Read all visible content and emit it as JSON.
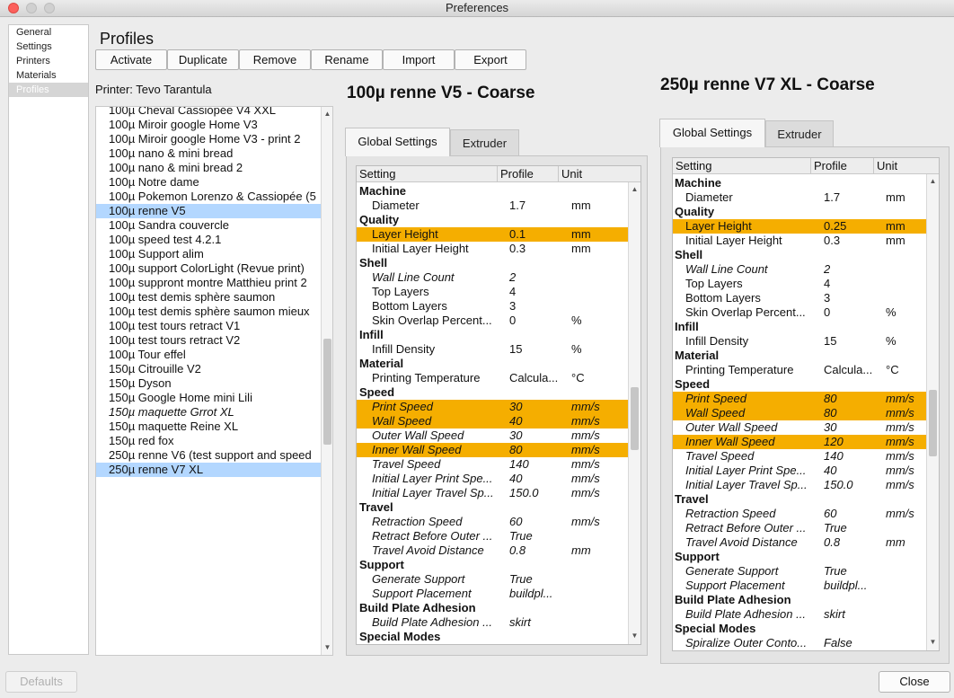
{
  "window": {
    "title": "Preferences"
  },
  "categories": [
    {
      "label": "General",
      "selected": false
    },
    {
      "label": "Settings",
      "selected": false
    },
    {
      "label": "Printers",
      "selected": false
    },
    {
      "label": "Materials",
      "selected": false
    },
    {
      "label": "Profiles",
      "selected": true
    }
  ],
  "page": {
    "heading": "Profiles",
    "printer_label": "Printer: Tevo Tarantula"
  },
  "toolbar": [
    "Activate",
    "Duplicate",
    "Remove",
    "Rename",
    "Import",
    "Export"
  ],
  "profiles": [
    {
      "name": "100µ Cheval Cassiopée V4 XXL",
      "selected": false,
      "italic": false
    },
    {
      "name": "100µ Miroir google Home V3",
      "selected": false,
      "italic": false
    },
    {
      "name": "100µ Miroir google Home V3 - print 2",
      "selected": false,
      "italic": false
    },
    {
      "name": "100µ nano & mini bread",
      "selected": false,
      "italic": false
    },
    {
      "name": "100µ nano & mini bread 2",
      "selected": false,
      "italic": false
    },
    {
      "name": "100µ Notre dame",
      "selected": false,
      "italic": false
    },
    {
      "name": "100µ Pokemon Lorenzo & Cassiopée (5",
      "selected": false,
      "italic": false
    },
    {
      "name": "100µ renne V5",
      "selected": true,
      "italic": false
    },
    {
      "name": "100µ Sandra couvercle",
      "selected": false,
      "italic": false
    },
    {
      "name": "100µ speed test 4.2.1",
      "selected": false,
      "italic": false
    },
    {
      "name": "100µ Support alim",
      "selected": false,
      "italic": false
    },
    {
      "name": "100µ support ColorLight (Revue print)",
      "selected": false,
      "italic": false
    },
    {
      "name": "100µ suppront montre Matthieu print 2",
      "selected": false,
      "italic": false
    },
    {
      "name": "100µ test demis sphère saumon",
      "selected": false,
      "italic": false
    },
    {
      "name": "100µ test demis sphère saumon mieux",
      "selected": false,
      "italic": false
    },
    {
      "name": "100µ test tours retract V1",
      "selected": false,
      "italic": false
    },
    {
      "name": "100µ test tours retract V2",
      "selected": false,
      "italic": false
    },
    {
      "name": "100µ Tour effel",
      "selected": false,
      "italic": false
    },
    {
      "name": "150µ Citrouille V2",
      "selected": false,
      "italic": false
    },
    {
      "name": "150µ Dyson",
      "selected": false,
      "italic": false
    },
    {
      "name": "150µ Google Home mini Lili",
      "selected": false,
      "italic": false
    },
    {
      "name": "150µ maquette Grrot XL",
      "selected": false,
      "italic": true
    },
    {
      "name": "150µ maquette Reine XL",
      "selected": false,
      "italic": false
    },
    {
      "name": "150µ red fox",
      "selected": false,
      "italic": false
    },
    {
      "name": "250µ renne V6 (test support and speed",
      "selected": false,
      "italic": false
    },
    {
      "name": "250µ renne V7 XL",
      "selected": true,
      "italic": false
    }
  ],
  "left_panel": {
    "title": "100µ renne V5 - Coarse",
    "tabs": [
      "Global Settings",
      "Extruder"
    ],
    "columns": [
      "Setting",
      "Profile",
      "Unit"
    ],
    "rows": [
      {
        "type": "cat",
        "setting": "Machine",
        "profile": "",
        "unit": "",
        "hl": false,
        "italic": false
      },
      {
        "type": "item",
        "setting": "Diameter",
        "profile": "1.7",
        "unit": "mm",
        "hl": false,
        "italic": false
      },
      {
        "type": "cat",
        "setting": "Quality",
        "profile": "",
        "unit": "",
        "hl": false,
        "italic": false
      },
      {
        "type": "item",
        "setting": "Layer Height",
        "profile": "0.1",
        "unit": "mm",
        "hl": true,
        "italic": false
      },
      {
        "type": "item",
        "setting": "Initial Layer Height",
        "profile": "0.3",
        "unit": "mm",
        "hl": false,
        "italic": false
      },
      {
        "type": "cat",
        "setting": "Shell",
        "profile": "",
        "unit": "",
        "hl": false,
        "italic": false
      },
      {
        "type": "item",
        "setting": "Wall Line Count",
        "profile": "2",
        "unit": "",
        "hl": false,
        "italic": true
      },
      {
        "type": "item",
        "setting": "Top Layers",
        "profile": "4",
        "unit": "",
        "hl": false,
        "italic": false
      },
      {
        "type": "item",
        "setting": "Bottom Layers",
        "profile": "3",
        "unit": "",
        "hl": false,
        "italic": false
      },
      {
        "type": "item",
        "setting": "Skin Overlap Percent...",
        "profile": "0",
        "unit": "%",
        "hl": false,
        "italic": false
      },
      {
        "type": "cat",
        "setting": "Infill",
        "profile": "",
        "unit": "",
        "hl": false,
        "italic": false
      },
      {
        "type": "item",
        "setting": "Infill Density",
        "profile": "15",
        "unit": "%",
        "hl": false,
        "italic": false
      },
      {
        "type": "cat",
        "setting": "Material",
        "profile": "",
        "unit": "",
        "hl": false,
        "italic": false
      },
      {
        "type": "item",
        "setting": "Printing Temperature",
        "profile": "Calcula...",
        "unit": "°C",
        "hl": false,
        "italic": false
      },
      {
        "type": "cat",
        "setting": "Speed",
        "profile": "",
        "unit": "",
        "hl": false,
        "italic": false
      },
      {
        "type": "item",
        "setting": "Print Speed",
        "profile": "30",
        "unit": "mm/s",
        "hl": true,
        "italic": true
      },
      {
        "type": "item",
        "setting": "Wall Speed",
        "profile": "40",
        "unit": "mm/s",
        "hl": true,
        "italic": true
      },
      {
        "type": "item",
        "setting": "Outer Wall Speed",
        "profile": "30",
        "unit": "mm/s",
        "hl": false,
        "italic": true
      },
      {
        "type": "item",
        "setting": "Inner Wall Speed",
        "profile": "80",
        "unit": "mm/s",
        "hl": true,
        "italic": true
      },
      {
        "type": "item",
        "setting": "Travel Speed",
        "profile": "140",
        "unit": "mm/s",
        "hl": false,
        "italic": true
      },
      {
        "type": "item",
        "setting": "Initial Layer Print Spe...",
        "profile": "40",
        "unit": "mm/s",
        "hl": false,
        "italic": true
      },
      {
        "type": "item",
        "setting": "Initial Layer Travel Sp...",
        "profile": "150.0",
        "unit": "mm/s",
        "hl": false,
        "italic": true
      },
      {
        "type": "cat",
        "setting": "Travel",
        "profile": "",
        "unit": "",
        "hl": false,
        "italic": false
      },
      {
        "type": "item",
        "setting": "Retraction Speed",
        "profile": "60",
        "unit": "mm/s",
        "hl": false,
        "italic": true
      },
      {
        "type": "item",
        "setting": "Retract Before Outer ...",
        "profile": "True",
        "unit": "",
        "hl": false,
        "italic": true
      },
      {
        "type": "item",
        "setting": "Travel Avoid Distance",
        "profile": "0.8",
        "unit": "mm",
        "hl": false,
        "italic": true
      },
      {
        "type": "cat",
        "setting": "Support",
        "profile": "",
        "unit": "",
        "hl": false,
        "italic": false
      },
      {
        "type": "item",
        "setting": "Generate Support",
        "profile": "True",
        "unit": "",
        "hl": false,
        "italic": true
      },
      {
        "type": "item",
        "setting": "Support Placement",
        "profile": "buildpl...",
        "unit": "",
        "hl": false,
        "italic": true
      },
      {
        "type": "cat",
        "setting": "Build Plate Adhesion",
        "profile": "",
        "unit": "",
        "hl": false,
        "italic": false
      },
      {
        "type": "item",
        "setting": "Build Plate Adhesion ...",
        "profile": "skirt",
        "unit": "",
        "hl": false,
        "italic": true
      },
      {
        "type": "cat",
        "setting": "Special Modes",
        "profile": "",
        "unit": "",
        "hl": false,
        "italic": false
      }
    ]
  },
  "right_panel": {
    "title": "250µ renne V7 XL - Coarse",
    "tabs": [
      "Global Settings",
      "Extruder"
    ],
    "columns": [
      "Setting",
      "Profile",
      "Unit"
    ],
    "rows": [
      {
        "type": "cat",
        "setting": "Machine",
        "profile": "",
        "unit": "",
        "hl": false,
        "italic": false
      },
      {
        "type": "item",
        "setting": "Diameter",
        "profile": "1.7",
        "unit": "mm",
        "hl": false,
        "italic": false
      },
      {
        "type": "cat",
        "setting": "Quality",
        "profile": "",
        "unit": "",
        "hl": false,
        "italic": false
      },
      {
        "type": "item",
        "setting": "Layer Height",
        "profile": "0.25",
        "unit": "mm",
        "hl": true,
        "italic": false
      },
      {
        "type": "item",
        "setting": "Initial Layer Height",
        "profile": "0.3",
        "unit": "mm",
        "hl": false,
        "italic": false
      },
      {
        "type": "cat",
        "setting": "Shell",
        "profile": "",
        "unit": "",
        "hl": false,
        "italic": false
      },
      {
        "type": "item",
        "setting": "Wall Line Count",
        "profile": "2",
        "unit": "",
        "hl": false,
        "italic": true
      },
      {
        "type": "item",
        "setting": "Top Layers",
        "profile": "4",
        "unit": "",
        "hl": false,
        "italic": false
      },
      {
        "type": "item",
        "setting": "Bottom Layers",
        "profile": "3",
        "unit": "",
        "hl": false,
        "italic": false
      },
      {
        "type": "item",
        "setting": "Skin Overlap Percent...",
        "profile": "0",
        "unit": "%",
        "hl": false,
        "italic": false
      },
      {
        "type": "cat",
        "setting": "Infill",
        "profile": "",
        "unit": "",
        "hl": false,
        "italic": false
      },
      {
        "type": "item",
        "setting": "Infill Density",
        "profile": "15",
        "unit": "%",
        "hl": false,
        "italic": false
      },
      {
        "type": "cat",
        "setting": "Material",
        "profile": "",
        "unit": "",
        "hl": false,
        "italic": false
      },
      {
        "type": "item",
        "setting": "Printing Temperature",
        "profile": "Calcula...",
        "unit": "°C",
        "hl": false,
        "italic": false
      },
      {
        "type": "cat",
        "setting": "Speed",
        "profile": "",
        "unit": "",
        "hl": false,
        "italic": false
      },
      {
        "type": "item",
        "setting": "Print Speed",
        "profile": "80",
        "unit": "mm/s",
        "hl": true,
        "italic": true
      },
      {
        "type": "item",
        "setting": "Wall Speed",
        "profile": "80",
        "unit": "mm/s",
        "hl": true,
        "italic": true
      },
      {
        "type": "item",
        "setting": "Outer Wall Speed",
        "profile": "30",
        "unit": "mm/s",
        "hl": false,
        "italic": true
      },
      {
        "type": "item",
        "setting": "Inner Wall Speed",
        "profile": "120",
        "unit": "mm/s",
        "hl": true,
        "italic": true
      },
      {
        "type": "item",
        "setting": "Travel Speed",
        "profile": "140",
        "unit": "mm/s",
        "hl": false,
        "italic": true
      },
      {
        "type": "item",
        "setting": "Initial Layer Print Spe...",
        "profile": "40",
        "unit": "mm/s",
        "hl": false,
        "italic": true
      },
      {
        "type": "item",
        "setting": "Initial Layer Travel Sp...",
        "profile": "150.0",
        "unit": "mm/s",
        "hl": false,
        "italic": true
      },
      {
        "type": "cat",
        "setting": "Travel",
        "profile": "",
        "unit": "",
        "hl": false,
        "italic": false
      },
      {
        "type": "item",
        "setting": "Retraction Speed",
        "profile": "60",
        "unit": "mm/s",
        "hl": false,
        "italic": true
      },
      {
        "type": "item",
        "setting": "Retract Before Outer ...",
        "profile": "True",
        "unit": "",
        "hl": false,
        "italic": true
      },
      {
        "type": "item",
        "setting": "Travel Avoid Distance",
        "profile": "0.8",
        "unit": "mm",
        "hl": false,
        "italic": true
      },
      {
        "type": "cat",
        "setting": "Support",
        "profile": "",
        "unit": "",
        "hl": false,
        "italic": false
      },
      {
        "type": "item",
        "setting": "Generate Support",
        "profile": "True",
        "unit": "",
        "hl": false,
        "italic": true
      },
      {
        "type": "item",
        "setting": "Support Placement",
        "profile": "buildpl...",
        "unit": "",
        "hl": false,
        "italic": true
      },
      {
        "type": "cat",
        "setting": "Build Plate Adhesion",
        "profile": "",
        "unit": "",
        "hl": false,
        "italic": false
      },
      {
        "type": "item",
        "setting": "Build Plate Adhesion ...",
        "profile": "skirt",
        "unit": "",
        "hl": false,
        "italic": true
      },
      {
        "type": "cat",
        "setting": "Special Modes",
        "profile": "",
        "unit": "",
        "hl": false,
        "italic": false
      },
      {
        "type": "item",
        "setting": "Spiralize Outer Conto...",
        "profile": "False",
        "unit": "",
        "hl": false,
        "italic": true
      }
    ]
  },
  "footer": {
    "defaults_label": "Defaults",
    "close_label": "Close"
  },
  "colors": {
    "highlight": "#f5ae00",
    "selection": "#b3d7ff",
    "close": "#fc605c",
    "minimize": "#d0d0d0",
    "zoom": "#d0d0d0"
  },
  "icons": {
    "scroll_up": "▲",
    "scroll_down": "▼"
  }
}
